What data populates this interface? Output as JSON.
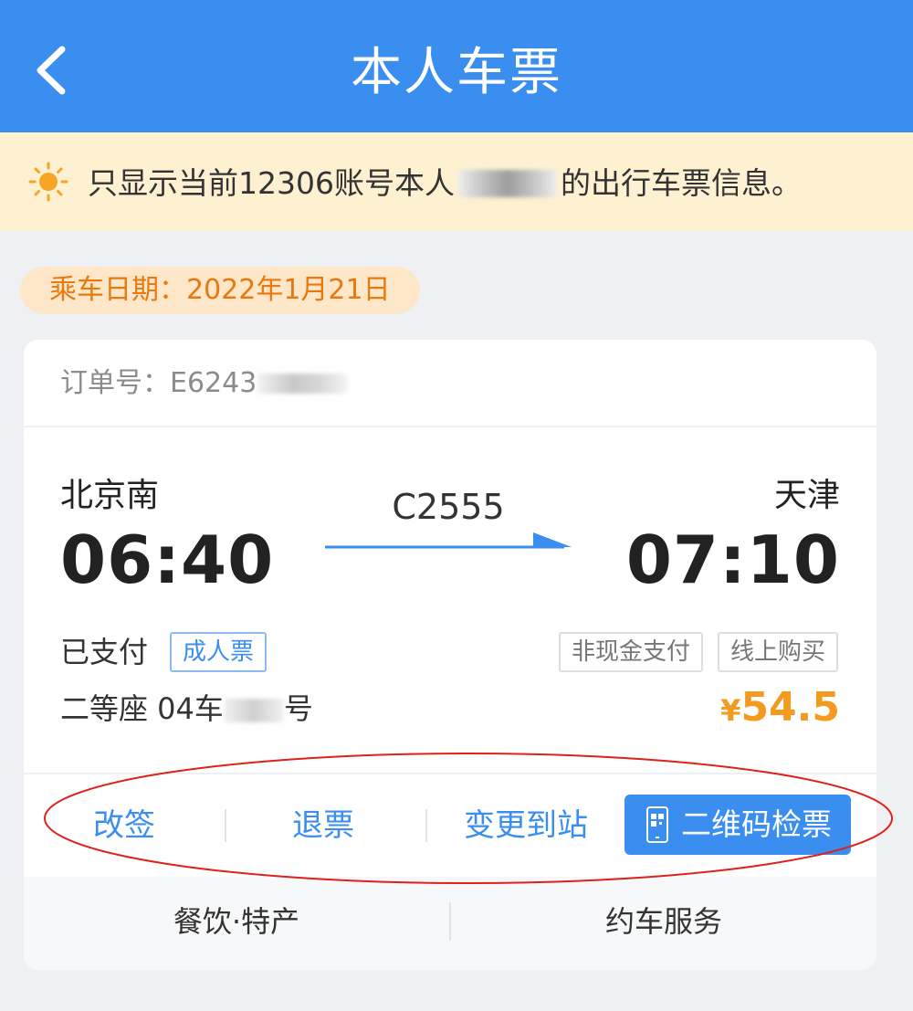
{
  "header": {
    "title": "本人车票"
  },
  "notice": {
    "text_before": "只显示当前12306账号本人",
    "text_after": "的出行车票信息。"
  },
  "travel_date": "乘车日期：2022年1月21日",
  "ticket": {
    "order_label": "订单号：E6243",
    "from_station": "北京南",
    "from_time": "06:40",
    "train_number": "C2555",
    "to_station": "天津",
    "to_time": "07:10",
    "payment_status": "已支付",
    "ticket_type": "成人票",
    "tag_cashless": "非现金支付",
    "tag_online": "线上购买",
    "seat_prefix": "二等座 04车",
    "seat_suffix": "号",
    "price_currency": "¥",
    "price_amount": "54.5"
  },
  "actions": {
    "change": "改签",
    "refund": "退票",
    "change_station": "变更到站",
    "qr_check": "二维码检票"
  },
  "services": {
    "food": "餐饮·特产",
    "car": "约车服务"
  },
  "colors": {
    "header_bg": "#3a8ef0",
    "notice_bg": "#fdf1d2",
    "accent_orange": "#f39a1f",
    "annotation_red": "#e0201a"
  }
}
